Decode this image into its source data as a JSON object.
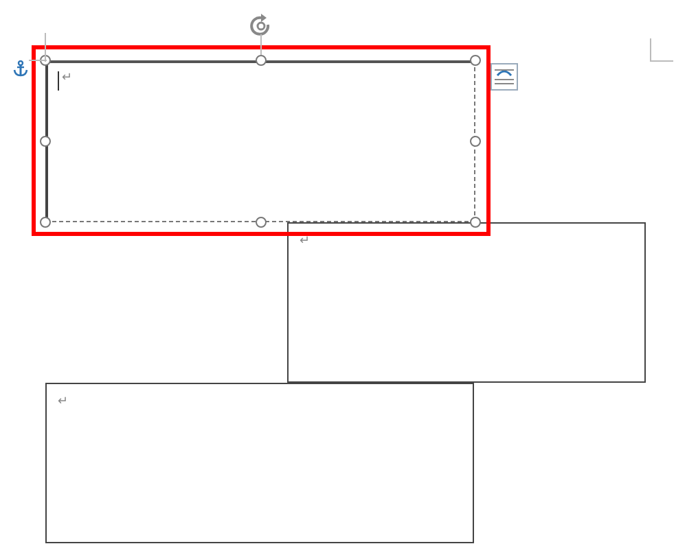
{
  "text_boxes": [
    {
      "selected": true,
      "highlighted": true,
      "paragraph_mark": "↵"
    },
    {
      "selected": false,
      "highlighted": false,
      "paragraph_mark": "↵"
    },
    {
      "selected": false,
      "highlighted": false,
      "paragraph_mark": "↵"
    }
  ]
}
